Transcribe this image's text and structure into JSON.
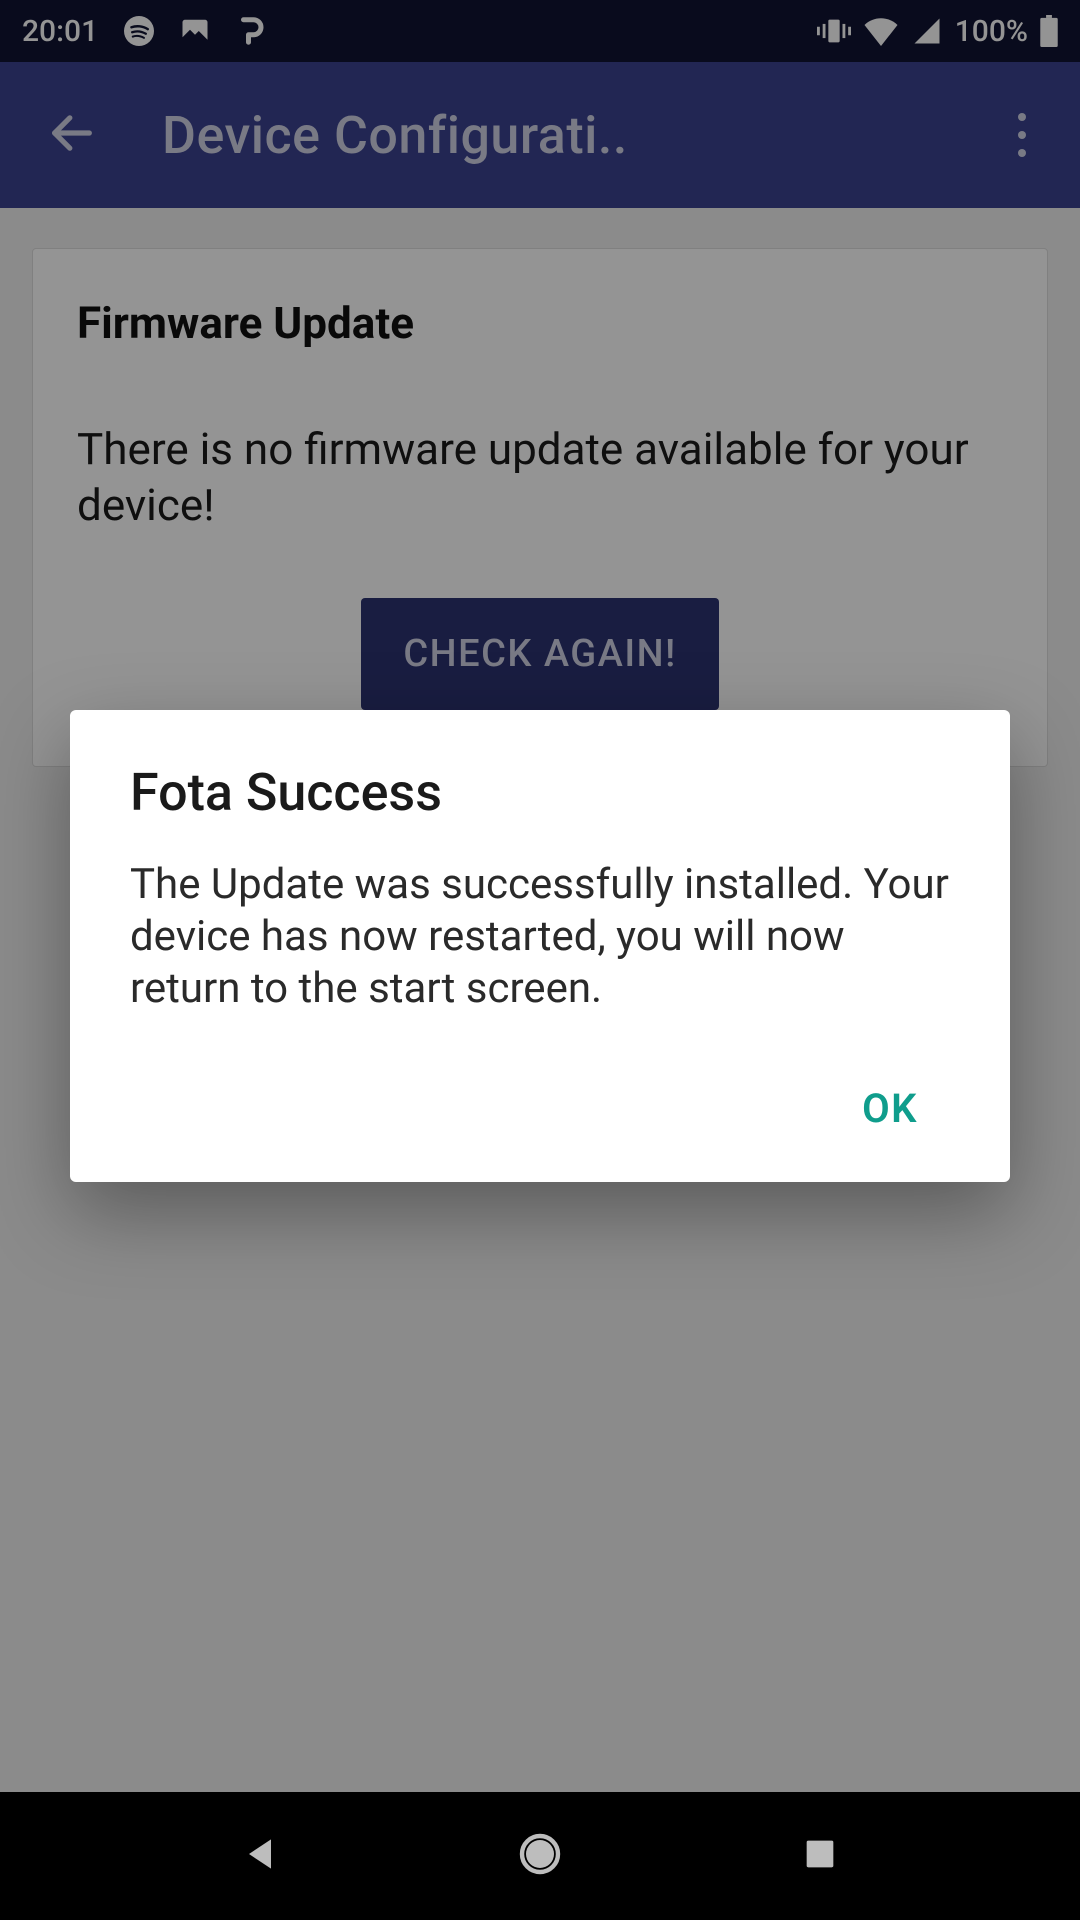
{
  "status": {
    "time": "20:01",
    "battery_text": "100%"
  },
  "appbar": {
    "title": "Device Configurati.."
  },
  "card": {
    "title": "Firmware Update",
    "body": "There is no firmware update available for your device!",
    "button": "CHECK AGAIN!"
  },
  "dialog": {
    "title": "Fota Success",
    "body": "The Update was successfully installed. Your device has now restarted, you will now return to the start screen.",
    "ok": "OK"
  }
}
